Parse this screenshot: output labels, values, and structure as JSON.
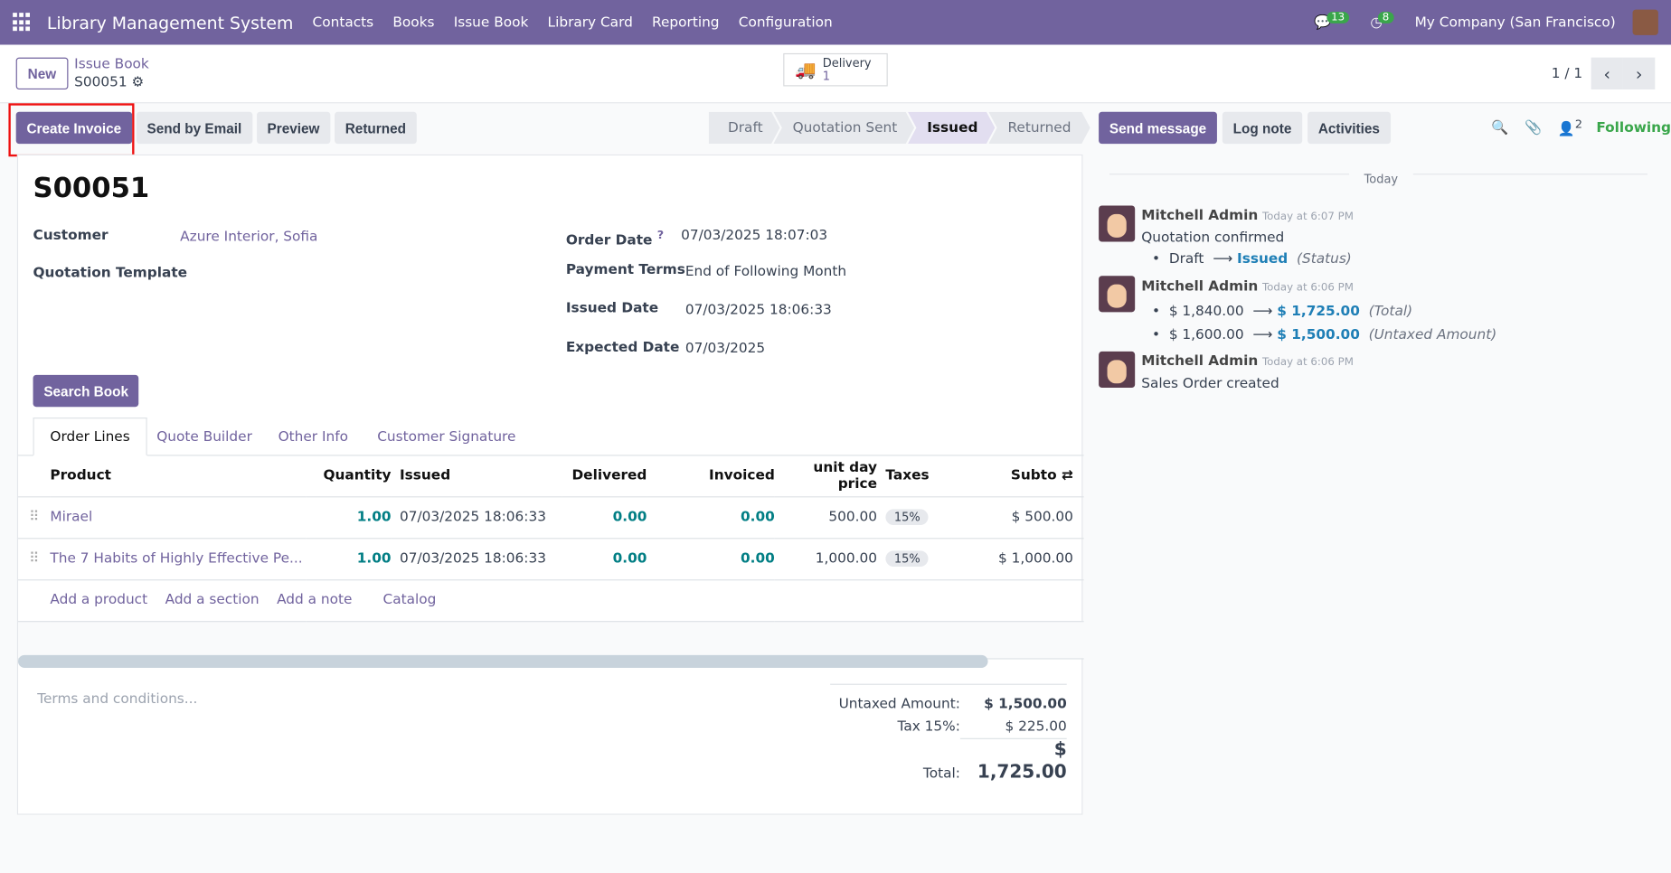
{
  "nav": {
    "brand": "Library Management System",
    "menus": [
      "Contacts",
      "Books",
      "Issue Book",
      "Library Card",
      "Reporting",
      "Configuration"
    ],
    "messages_count": "13",
    "activities_count": "8",
    "company": "My Company (San Francisco)"
  },
  "control": {
    "new": "New",
    "breadcrumb": "Issue Book",
    "record": "S00051",
    "smart_label": "Delivery",
    "smart_count": "1",
    "pager": "1 / 1"
  },
  "actions": [
    "Create Invoice",
    "Send by Email",
    "Preview",
    "Returned"
  ],
  "steps": [
    "Draft",
    "Quotation Sent",
    "Issued",
    "Returned"
  ],
  "chatter_buttons": {
    "send": "Send message",
    "log": "Log note",
    "activities": "Activities",
    "followers": "2",
    "following": "Following"
  },
  "form": {
    "name": "S00051",
    "customer_label": "Customer",
    "customer": "Azure Interior, Sofia",
    "template_label": "Quotation Template",
    "order_date_label": "Order Date",
    "order_date_help": "?",
    "order_date": "07/03/2025 18:07:03",
    "payment_terms_label": "Payment Terms",
    "payment_terms": "End of Following Month",
    "issued_date_label": "Issued Date",
    "issued_date": "07/03/2025 18:06:33",
    "expected_date_label": "Expected Date",
    "expected_date": "07/03/2025",
    "search_book": "Search Book"
  },
  "tabs": [
    "Order Lines",
    "Quote Builder",
    "Other Info",
    "Customer Signature"
  ],
  "lines": {
    "headers": [
      "Product",
      "Quantity",
      "Issued",
      "Delivered",
      "Invoiced",
      "unit day price",
      "Taxes",
      "Subto"
    ],
    "rows": [
      [
        "Mirael",
        "1.00",
        "07/03/2025 18:06:33",
        "0.00",
        "0.00",
        "500.00",
        "15%",
        "$ 500.00"
      ],
      [
        "The 7 Habits of Highly Effective Pe...",
        "1.00",
        "07/03/2025 18:06:33",
        "0.00",
        "0.00",
        "1,000.00",
        "15%",
        "$ 1,000.00"
      ]
    ],
    "add": [
      "Add a product",
      "Add a section",
      "Add a note",
      "Catalog"
    ]
  },
  "terms_placeholder": "Terms and conditions...",
  "totals": {
    "untaxed_label": "Untaxed Amount:",
    "untaxed": "$ 1,500.00",
    "tax_label": "Tax 15%:",
    "tax": "$ 225.00",
    "total_label": "Total:",
    "total": "$ 1,725.00"
  },
  "chatter": {
    "today": "Today",
    "messages": [
      {
        "author": "Mitchell Admin",
        "time": "Today at 6:07 PM",
        "body": "Quotation confirmed",
        "changes": [
          {
            "old": "Draft",
            "new": "Issued",
            "field": "(Status)"
          }
        ]
      },
      {
        "author": "Mitchell Admin",
        "time": "Today at 6:06 PM",
        "changes": [
          {
            "old": "$ 1,840.00",
            "new": "$ 1,725.00",
            "field": "(Total)"
          },
          {
            "old": "$ 1,600.00",
            "new": "$ 1,500.00",
            "field": "(Untaxed Amount)"
          }
        ]
      },
      {
        "author": "Mitchell Admin",
        "time": "Today at 6:06 PM",
        "body": "Sales Order created"
      }
    ]
  }
}
